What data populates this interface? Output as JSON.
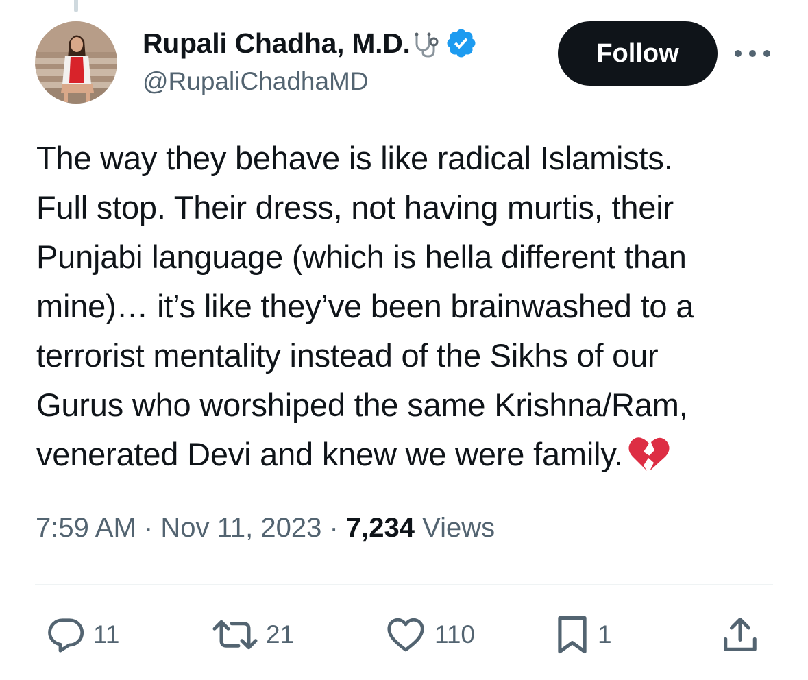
{
  "author": {
    "display_name": "Rupali Chadha, M.D.",
    "handle": "@RupaliChadhaMD",
    "name_emoji": "stethoscope-icon",
    "verified_badge": "verified-icon"
  },
  "header": {
    "follow_label": "Follow",
    "more_icon": "more-icon"
  },
  "tweet": {
    "lines": [
      "The way they behave is like radical Islamists.",
      "Full stop. Their dress, not having murtis, their",
      "Punjabi language (which is hella different than",
      "mine)… it’s like they’ve been brainwashed to a",
      "terrorist mentality instead of the Sikhs of our",
      "Gurus who worshiped the same Krishna/Ram,",
      "venerated Devi and knew we were family."
    ],
    "emoji": "broken-heart-icon"
  },
  "meta": {
    "time": "7:59 AM",
    "separator": "·",
    "date": "Nov 11, 2023",
    "views_count": "7,234",
    "views_label": "Views"
  },
  "actions": {
    "replies": "11",
    "retweets": "21",
    "likes": "110",
    "bookmarks": "1"
  },
  "colors": {
    "text": "#0f1419",
    "secondary": "#536471",
    "verified": "#1d9bf0",
    "divider": "#eff3f4",
    "broken_heart": "#dd2e44"
  }
}
